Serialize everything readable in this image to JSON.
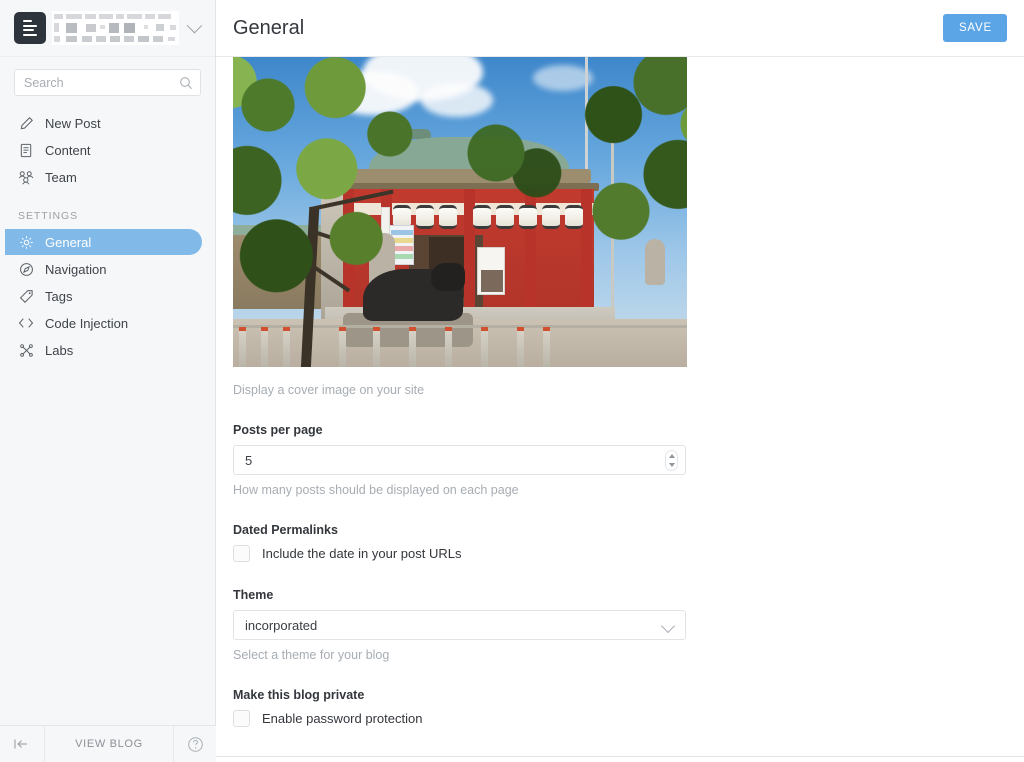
{
  "sidebar": {
    "logo_icon": "ghost-admin-logo-icon",
    "blog_title_redacted": true,
    "chevron_icon": "chevron-down-icon",
    "search": {
      "placeholder": "Search",
      "value": "",
      "icon": "search-icon"
    },
    "items": [
      {
        "label": "New Post",
        "icon": "pencil-icon",
        "selected": false
      },
      {
        "label": "Content",
        "icon": "document-icon",
        "selected": false
      },
      {
        "label": "Team",
        "icon": "people-icon",
        "selected": false
      }
    ],
    "group_label": "SETTINGS",
    "settings_items": [
      {
        "label": "General",
        "icon": "gear-icon",
        "selected": true
      },
      {
        "label": "Navigation",
        "icon": "compass-icon",
        "selected": false
      },
      {
        "label": "Tags",
        "icon": "tag-icon",
        "selected": false
      },
      {
        "label": "Code Injection",
        "icon": "code-brackets-icon",
        "selected": false
      },
      {
        "label": "Labs",
        "icon": "labs-molecule-icon",
        "selected": false
      }
    ],
    "footer": {
      "collapse_icon": "collapse-left-icon",
      "view_blog_label": "VIEW BLOG",
      "help_icon": "question-mark-circle-icon"
    }
  },
  "header": {
    "title": "General",
    "save_label": "SAVE"
  },
  "form": {
    "cover": {
      "hint": "Display a cover image on your site",
      "alt": "Japanese shrine cover photo with red hall, green copper roof, white lanterns, ox statue and trees"
    },
    "posts_per_page": {
      "label": "Posts per page",
      "value": "5",
      "hint": "How many posts should be displayed on each page"
    },
    "dated_permalinks": {
      "label": "Dated Permalinks",
      "checkbox_label": "Include the date in your post URLs",
      "checked": false
    },
    "theme": {
      "label": "Theme",
      "value": "incorporated",
      "hint": "Select a theme for your blog",
      "options": [
        "incorporated"
      ]
    },
    "private_blog": {
      "label": "Make this blog private",
      "checkbox_label": "Enable password protection",
      "checked": false
    }
  },
  "colors": {
    "accent_blue": "#5ba4e5",
    "selected_nav_blue": "#81bae8",
    "sidebar_bg": "#f6f7f8",
    "text_dark": "#33373c",
    "text_muted": "#a7adb3"
  }
}
